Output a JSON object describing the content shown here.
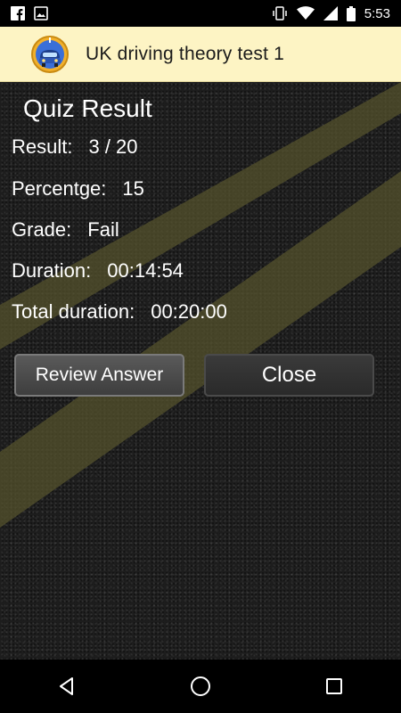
{
  "status_bar": {
    "time": "5:53",
    "left_icons": [
      "facebook-icon",
      "image-icon"
    ],
    "right_icons": [
      "vibrate-icon",
      "wifi-icon",
      "signal-icon",
      "battery-icon"
    ]
  },
  "app_bar": {
    "title": "UK driving theory test 1",
    "logo_icon": "car-logo-icon",
    "background_color": "#fdf4c4"
  },
  "quiz": {
    "title": "Quiz Result",
    "rows": [
      {
        "label": "Result:",
        "value": "3 / 20"
      },
      {
        "label": "Percentge:",
        "value": "15"
      },
      {
        "label": "Grade:",
        "value": "Fail"
      },
      {
        "label": "Duration:",
        "value": "00:14:54"
      },
      {
        "label": "Total duration:",
        "value": "00:20:00"
      }
    ]
  },
  "buttons": {
    "review_label": "Review Answer",
    "close_label": "Close"
  },
  "nav_bar": {
    "icons": [
      "back-icon",
      "home-icon",
      "recents-icon"
    ]
  }
}
